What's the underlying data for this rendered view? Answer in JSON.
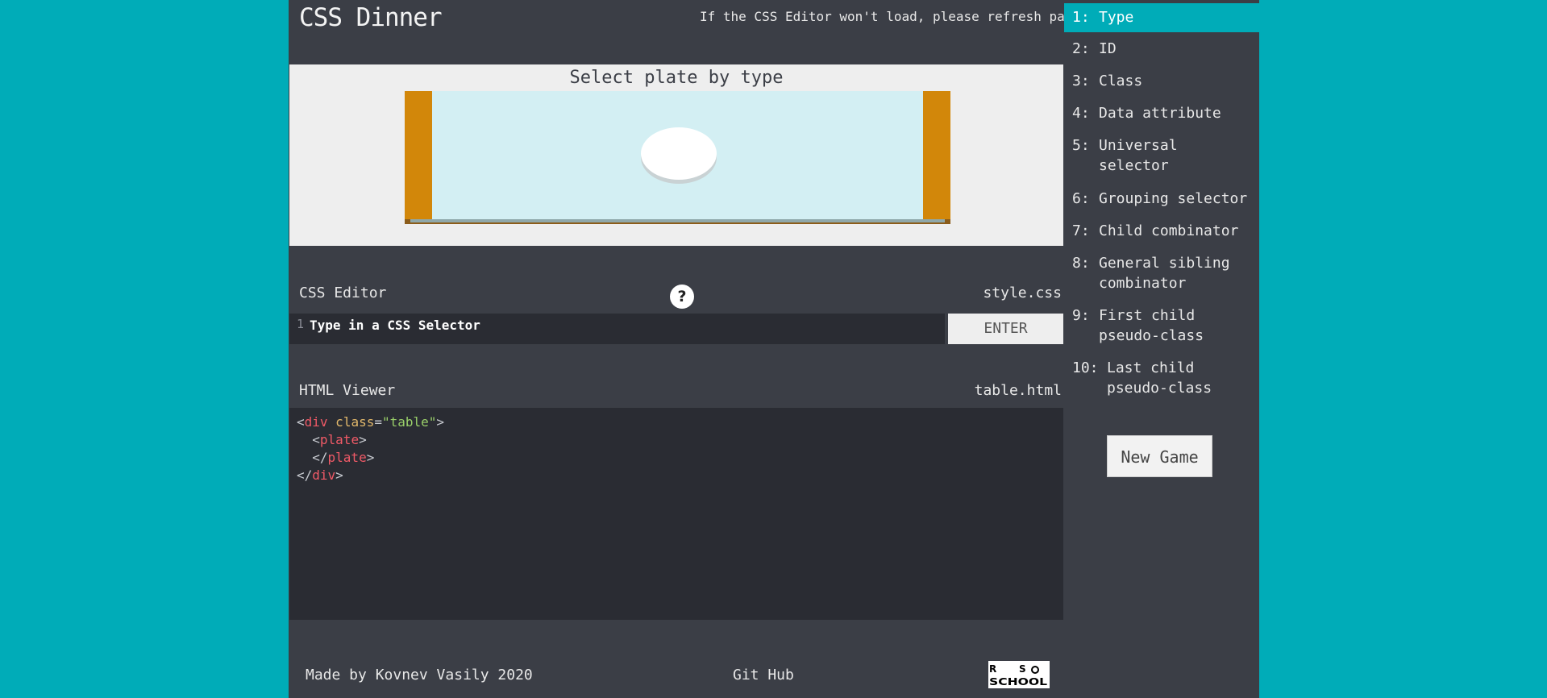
{
  "header": {
    "title": "CSS Dinner",
    "refresh_note": "If the CSS Editor won't load, please refresh page"
  },
  "stage": {
    "instruction": "Select plate by type"
  },
  "css_editor": {
    "label": "CSS Editor",
    "help_label": "?",
    "file_name": "style.css",
    "line_number": "1",
    "input_placeholder": "Type in a CSS Selector",
    "enter_label": "ENTER"
  },
  "html_viewer": {
    "label": "HTML Viewer",
    "file_name": "table.html",
    "code": {
      "l1_open": "<",
      "l1_tag": "div",
      "l1_attr": " class",
      "l1_eq": "=",
      "l1_val": "\"table\"",
      "l1_close": ">",
      "l2_open": "  <",
      "l2_tag": "plate",
      "l2_close": ">",
      "l3_open": "  </",
      "l3_tag": "plate",
      "l3_close": ">",
      "l4_open": "</",
      "l4_tag": "div",
      "l4_close": ">"
    }
  },
  "footer": {
    "credit": "Made by Kovnev Vasily 2020",
    "github": "Git Hub",
    "logo_text": "RS SCHOOL"
  },
  "sidebar": {
    "levels": [
      {
        "num": "1:",
        "line1": "Type",
        "line2": "",
        "active": true
      },
      {
        "num": "2:",
        "line1": "ID",
        "line2": "",
        "active": false
      },
      {
        "num": "3:",
        "line1": "Class",
        "line2": "",
        "active": false
      },
      {
        "num": "4:",
        "line1": "Data attribute",
        "line2": "",
        "active": false
      },
      {
        "num": "5:",
        "line1": "Universal",
        "line2": "selector",
        "active": false
      },
      {
        "num": "6:",
        "line1": "Grouping selector",
        "line2": "",
        "active": false
      },
      {
        "num": "7:",
        "line1": "Child combinator",
        "line2": "",
        "active": false
      },
      {
        "num": "8:",
        "line1": "General sibling",
        "line2": "combinator",
        "active": false
      },
      {
        "num": "9:",
        "line1": "First child",
        "line2": "pseudo-class",
        "active": false
      },
      {
        "num": "10:",
        "line1": "Last child",
        "line2": "pseudo-class",
        "active": false
      }
    ],
    "new_game_label": "New Game"
  },
  "colors": {
    "background": "#00acb8",
    "panel": "#3b3e46",
    "code_bg": "#2a2c33",
    "accent": "#00acb8",
    "table_leg": "#d2870a"
  }
}
